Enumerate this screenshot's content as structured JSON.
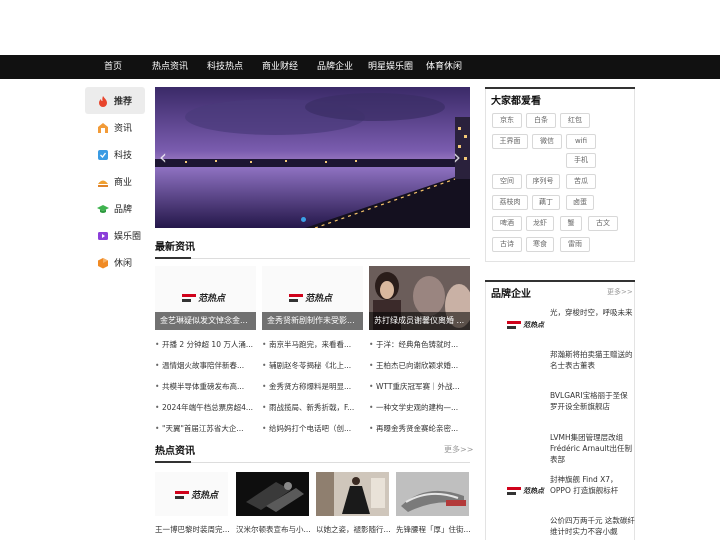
{
  "nav": {
    "items": [
      "首页",
      "热点资讯",
      "科技热点",
      "商业财经",
      "品牌企业",
      "明星娱乐圈",
      "体育休闲"
    ]
  },
  "sidebar": {
    "items": [
      {
        "label": "推荐",
        "icon": "flame-icon",
        "color": "#e8452c",
        "active": true
      },
      {
        "label": "资讯",
        "icon": "news-icon",
        "color": "#f29b38",
        "active": false
      },
      {
        "label": "科技",
        "icon": "tech-icon",
        "color": "#3a9be3",
        "active": false
      },
      {
        "label": "商业",
        "icon": "business-icon",
        "color": "#f0a030",
        "active": false
      },
      {
        "label": "品牌",
        "icon": "brand-icon",
        "color": "#3fb34f",
        "active": false
      },
      {
        "label": "娱乐圈",
        "icon": "entertainment-icon",
        "color": "#8b3fd9",
        "active": false
      },
      {
        "label": "休闲",
        "icon": "leisure-icon",
        "color": "#f08a24",
        "active": false
      }
    ]
  },
  "latest": {
    "title": "最新资讯",
    "cards": [
      {
        "caption": "金艺琳疑似发文悼念金...",
        "logo": "范热点"
      },
      {
        "caption": "金秀贤新剧制作未受影...",
        "logo": "范热点"
      },
      {
        "caption": "苏打绿成员谢馨仪离婚 ..."
      }
    ],
    "columns": [
      [
        "开播 2 分钟超 10 万人涌...",
        "温情烟火故事陪伴新春...",
        "共模半导体重磅发布高...",
        "2024年端午档总票房超4...",
        "\"天翼\"首届江苏省大企..."
      ],
      [
        "南京半马跑完，来看看...",
        "辅剧赵冬苓揭秘《北上...",
        "金秀贤方称爆料是明显...",
        "雨战揽局、新秀折戟，F...",
        "给妈妈打个电话吧（创..."
      ],
      [
        "于洋：经典角色铸就时...",
        "王柏杰已向谢欣颖求婚...",
        "WTT重庆冠军赛｜外战...",
        "一种文学史观的建构—...",
        "再曝金秀贤金赛纶亲密..."
      ]
    ]
  },
  "hot": {
    "title": "热点资讯",
    "more": "更多>>",
    "cards": [
      {
        "caption": "王一博巴黎时装周完...",
        "logo": "范热点"
      },
      {
        "caption": "汉米尔顿表宣布与小..."
      },
      {
        "caption": "以她之姿，褪影随行..."
      },
      {
        "caption": "先锋腰程「厚」住街..."
      }
    ]
  },
  "popular": {
    "title": "大家都爱看",
    "tags": [
      "京东",
      "白条",
      "红包",
      "王界面",
      "微信",
      "wifi",
      "手机",
      "空间",
      "序列号",
      "苦瓜",
      "荔枝肉",
      "藕丁",
      "卤蛋",
      "啤酒",
      "龙虾",
      "蟹",
      "古文",
      "古诗",
      "寒食",
      "雷雨"
    ]
  },
  "brands": {
    "title": "品牌企业",
    "more": "更多>>",
    "items": [
      {
        "text": "光，穿梭时空，呼吸未来",
        "logo": "范热点"
      },
      {
        "text": "邦瀚斯将拍卖猫王赠送的名士表古董表"
      },
      {
        "text": "BVLGARI宝格丽于圣保罗开设全新旗舰店"
      },
      {
        "text": "LVMH集团管理层改组 Frédéric Arnault出任制表部"
      },
      {
        "text": "封神旗舰 Find X7，OPPO 打造旗舰标杆",
        "logo": "范热点"
      },
      {
        "text": "公价四万两千元 这款碳纤维计时实力不容小觑"
      }
    ]
  }
}
